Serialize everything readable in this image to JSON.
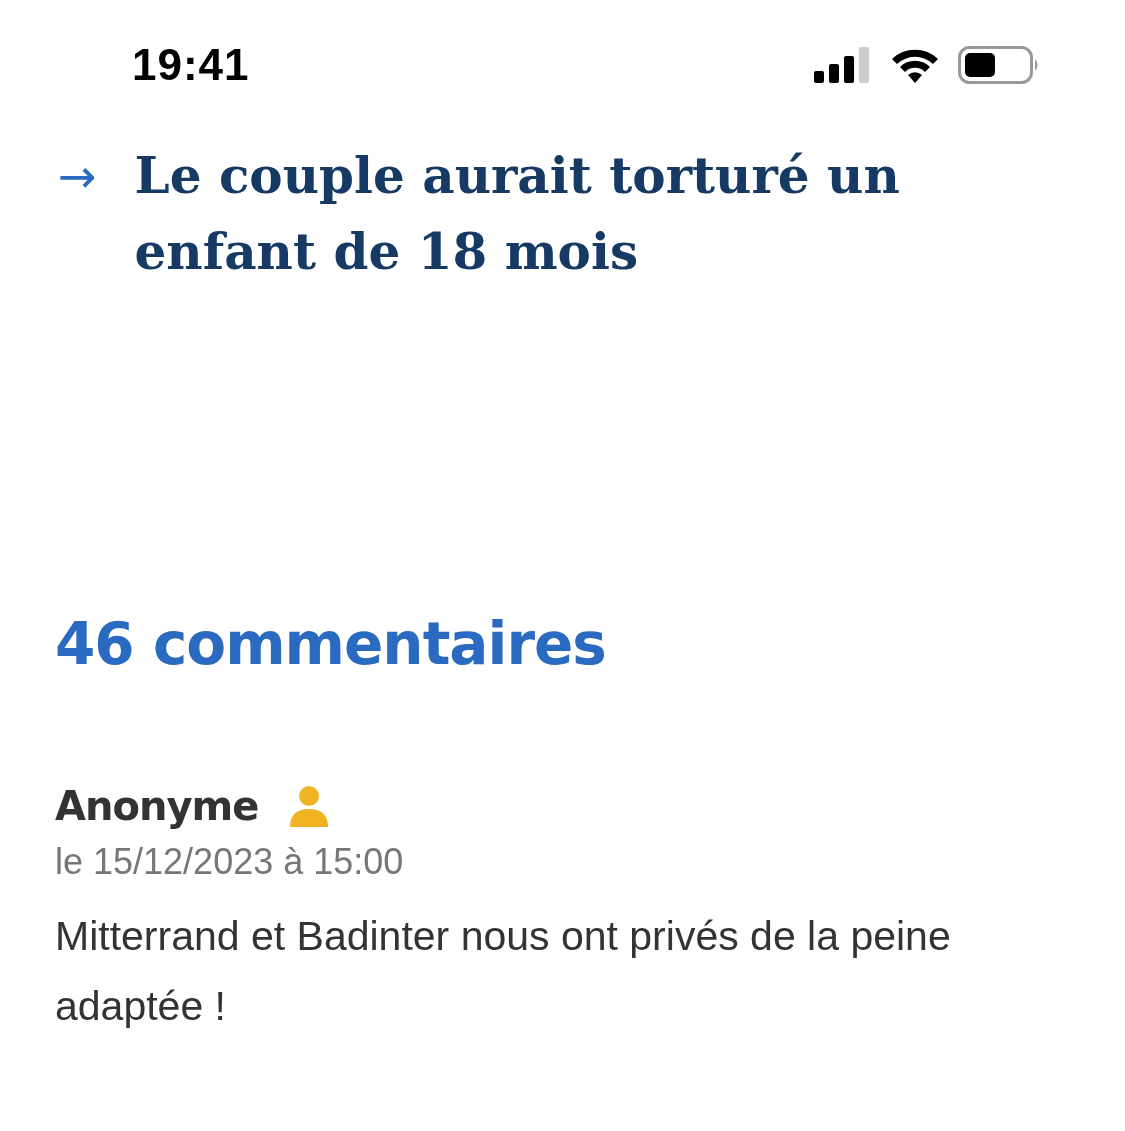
{
  "status_bar": {
    "time": "19:41"
  },
  "article_link": {
    "arrow": "→",
    "title": "Le couple aurait torturé un enfant de 18 mois"
  },
  "comments": {
    "heading": "46 commentaires",
    "items": [
      {
        "author": "Anonyme",
        "date": "le 15/12/2023 à 15:00",
        "text": "Mitterrand et Badinter nous ont privés de la peine adaptée !"
      }
    ]
  }
}
